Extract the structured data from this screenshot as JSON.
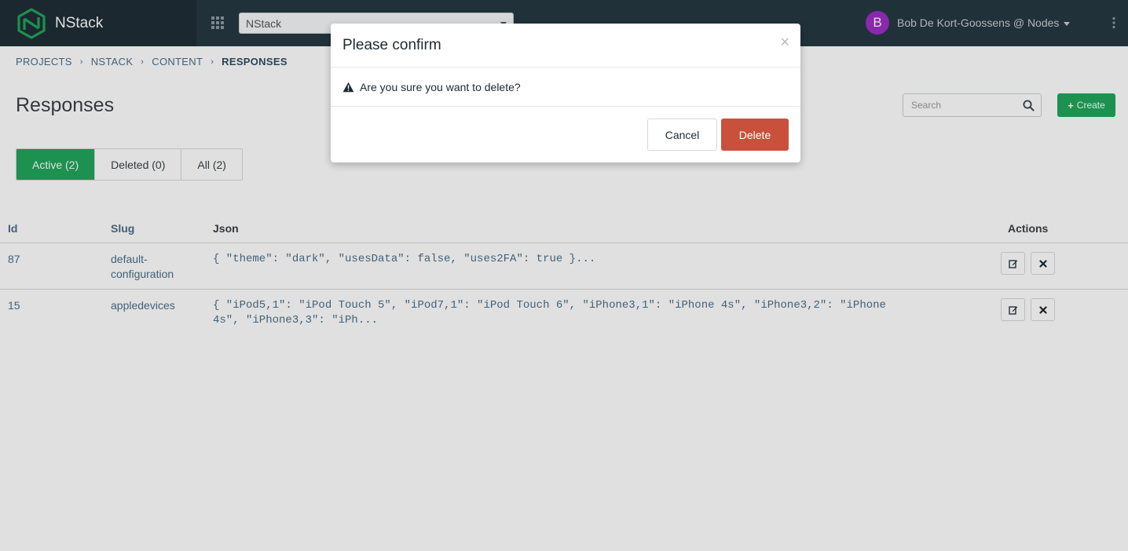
{
  "colors": {
    "nav_bg": "#263843",
    "brand_bg": "#1f2e37",
    "accent_green": "#22a65a",
    "danger_red": "#c9503a",
    "avatar_purple": "#9c2fc4",
    "link_blue": "#4a6f88"
  },
  "app": {
    "name": "NStack",
    "logo_icon": "nstack-logo"
  },
  "topnav": {
    "apps_icon": "grid-icon",
    "project_select": {
      "value": "NStack"
    },
    "user": {
      "initial": "B",
      "name": "Bob De Kort-Goossens @ Nodes"
    },
    "more_icon": "kebab-icon"
  },
  "breadcrumb": [
    "PROJECTS",
    "NSTACK",
    "CONTENT",
    "RESPONSES"
  ],
  "breadcrumb_separator": "›",
  "page": {
    "title": "Responses"
  },
  "search": {
    "placeholder": "Search"
  },
  "create_button": {
    "icon": "+",
    "label": "Create"
  },
  "tabs": [
    {
      "label": "Active (2)",
      "active": true
    },
    {
      "label": "Deleted (0)",
      "active": false
    },
    {
      "label": "All (2)",
      "active": false
    }
  ],
  "table": {
    "columns": [
      "Id",
      "Slug",
      "Json",
      "Actions"
    ],
    "rows": [
      {
        "id": "87",
        "slug": "default-configuration",
        "json": "{ \"theme\": \"dark\", \"usesData\": false, \"uses2FA\": true }..."
      },
      {
        "id": "15",
        "slug": "appledevices",
        "json": "{ \"iPod5,1\": \"iPod Touch 5\", \"iPod7,1\": \"iPod Touch 6\", \"iPhone3,1\": \"iPhone 4s\", \"iPhone3,2\": \"iPhone 4s\", \"iPhone3,3\": \"iPh..."
      }
    ]
  },
  "modal": {
    "title": "Please confirm",
    "close": "×",
    "message": "Are you sure you want to delete?",
    "cancel_label": "Cancel",
    "delete_label": "Delete"
  }
}
